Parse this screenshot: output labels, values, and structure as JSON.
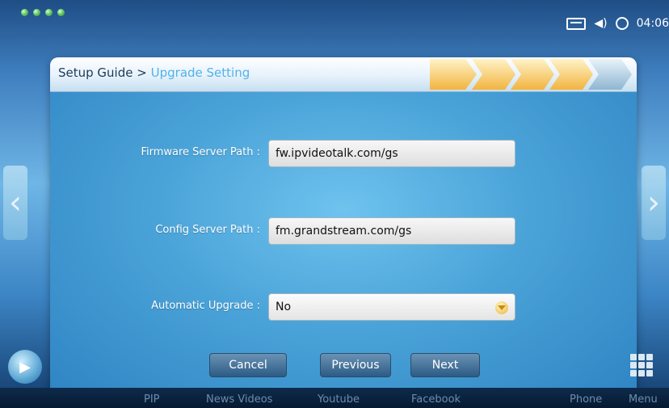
{
  "status": {
    "clock": "04:06"
  },
  "header": {
    "breadcrumb_root": "Setup Guide",
    "breadcrumb_separator": ">",
    "current_page": "Upgrade Setting"
  },
  "form": {
    "firmware_label": "Firmware Server Path :",
    "firmware_value": "fw.ipvideotalk.com/gs",
    "config_label": "Config Server Path :",
    "config_value": "fm.grandstream.com/gs",
    "auto_label": "Automatic Upgrade :",
    "auto_value": "No"
  },
  "buttons": {
    "cancel": "Cancel",
    "previous": "Previous",
    "next": "Next"
  },
  "dock": {
    "pip": "PIP",
    "news": "News Videos",
    "youtube": "Youtube",
    "facebook": "Facebook",
    "phone": "Phone",
    "menu": "Menu"
  },
  "colors": {
    "accent_current": "#50b2ec",
    "step_active": "#f2b43f",
    "dialog_bg": "#4aa3d8"
  },
  "icons": [
    "status-dot-icon",
    "keyboard-icon",
    "volume-icon",
    "sync-icon",
    "chevron-left-icon",
    "chevron-right-icon",
    "dropdown-arrow-icon",
    "home-icon",
    "grid-menu-icon"
  ]
}
